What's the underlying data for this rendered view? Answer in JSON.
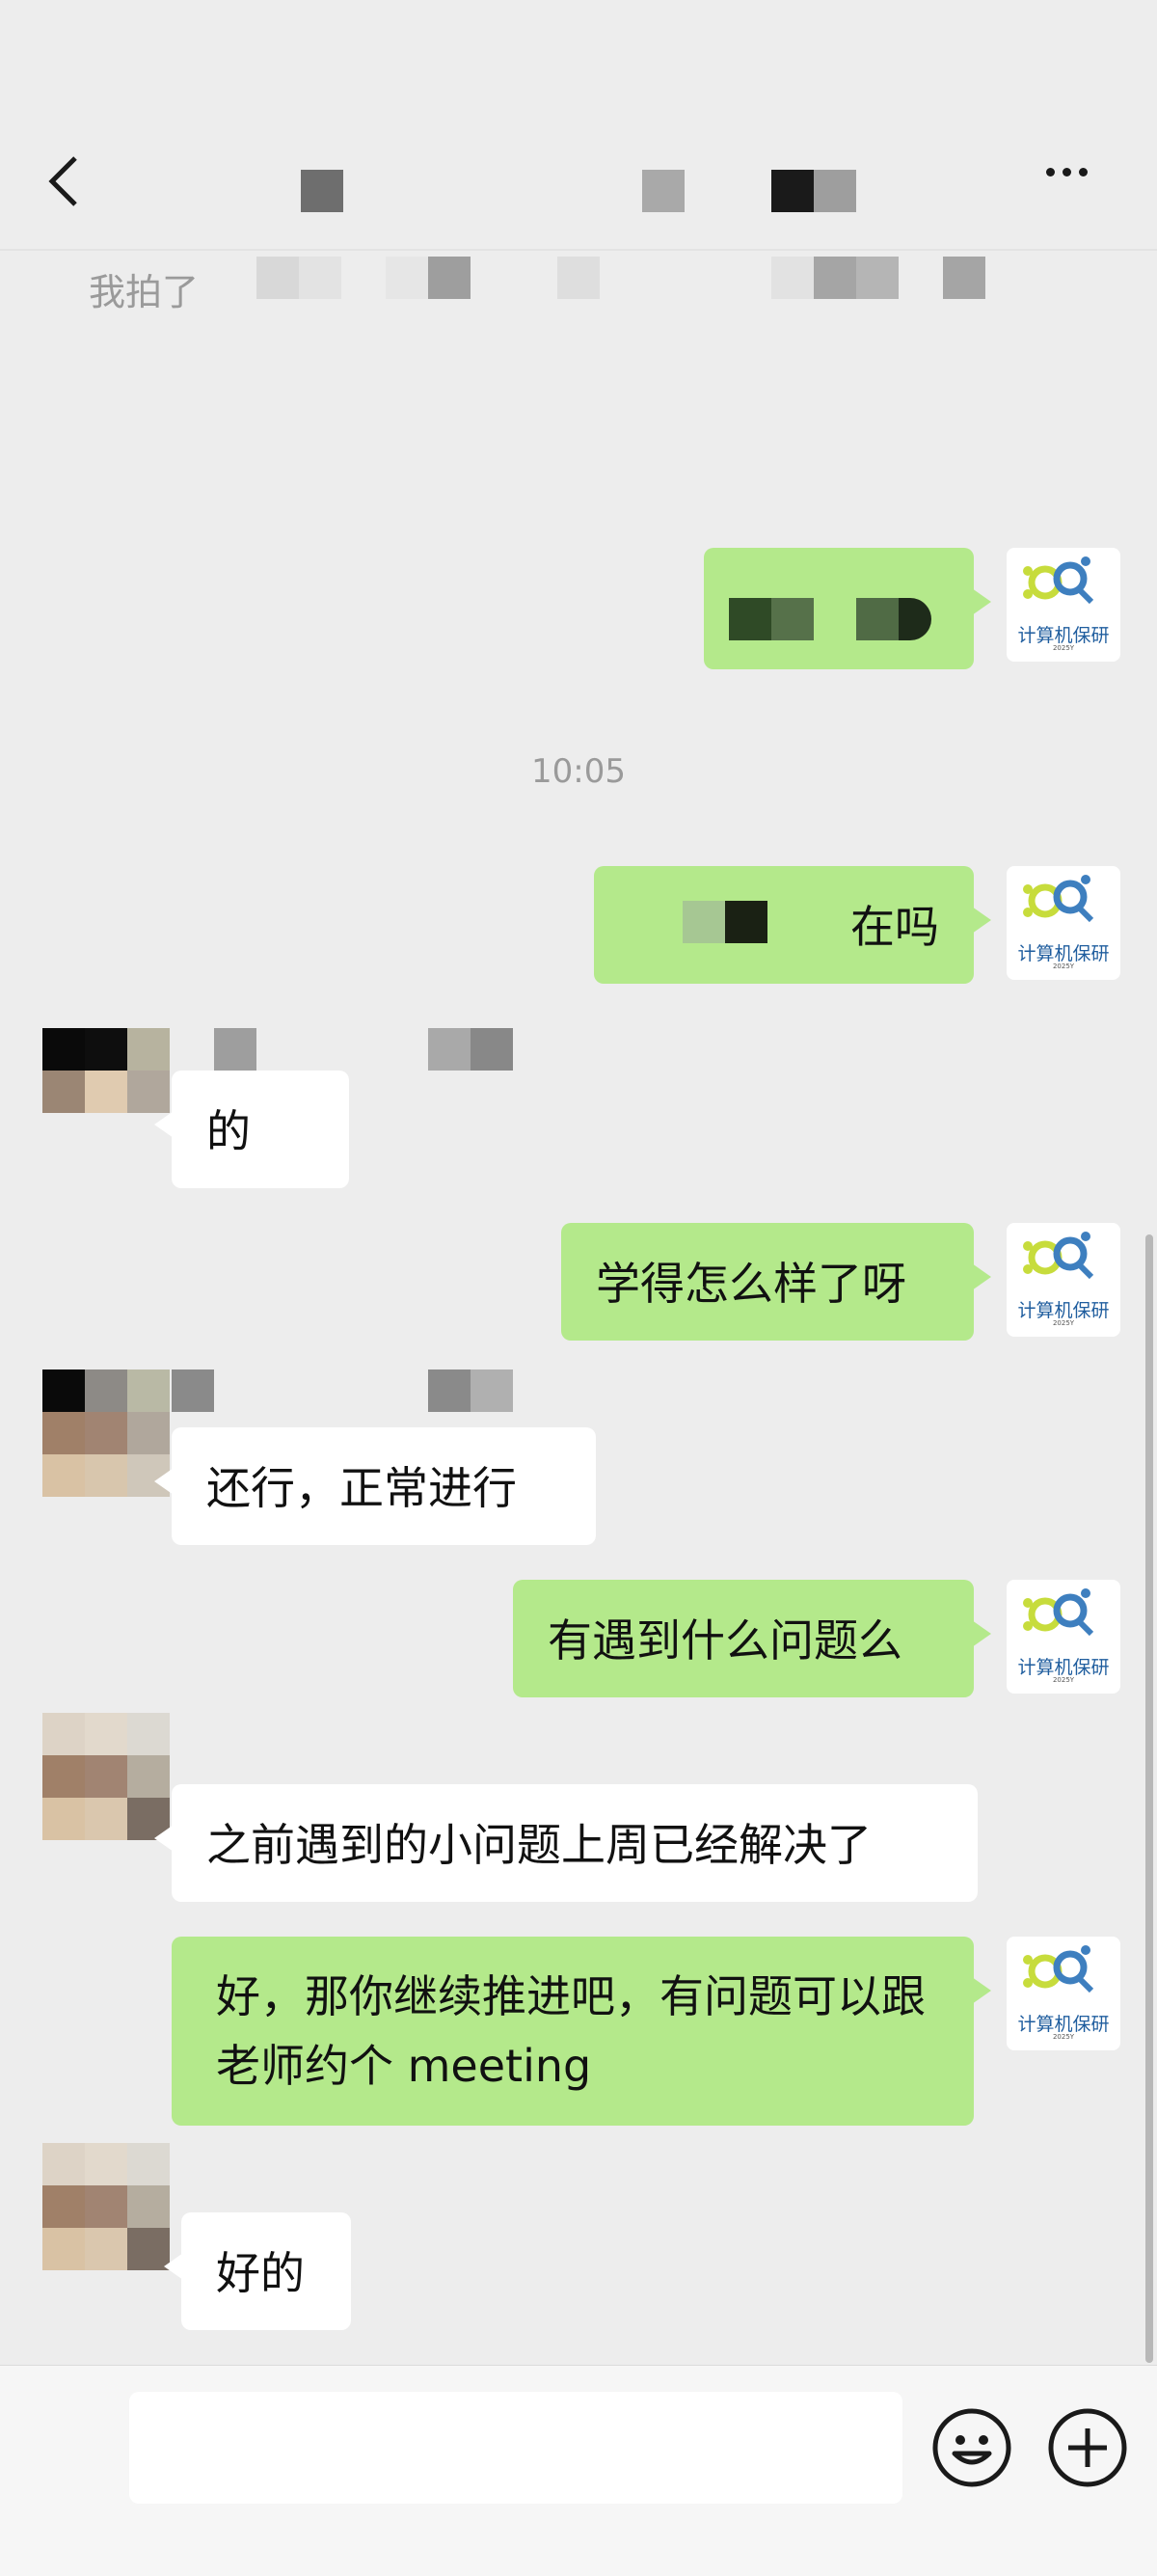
{
  "header": {
    "back_icon": "back-chevron-icon",
    "more_icon": "more-dots-icon"
  },
  "system_message": {
    "text_visible": "我拍了"
  },
  "timestamp": "10:05",
  "avatar_logo": {
    "text": "计算机保研",
    "sub": "2025Y"
  },
  "messages": [
    {
      "side": "right",
      "text": "在吗"
    },
    {
      "side": "left",
      "text": "的"
    },
    {
      "side": "right",
      "text": "学得怎么样了呀"
    },
    {
      "side": "left",
      "text": "还行，正常进行"
    },
    {
      "side": "right",
      "text": "有遇到什么问题么"
    },
    {
      "side": "left",
      "text": "之前遇到的小问题上周已经解决了"
    },
    {
      "side": "right",
      "text": "好，那你继续推进吧，有问题可以跟老师约个 meeting"
    },
    {
      "side": "left",
      "text": "好的"
    }
  ],
  "input_bar": {
    "value": "",
    "emoji_icon": "emoji-icon",
    "plus_icon": "plus-icon"
  },
  "colors": {
    "background": "#ededed",
    "bubble_me": "#b4e98b",
    "bubble_them": "#ffffff"
  }
}
